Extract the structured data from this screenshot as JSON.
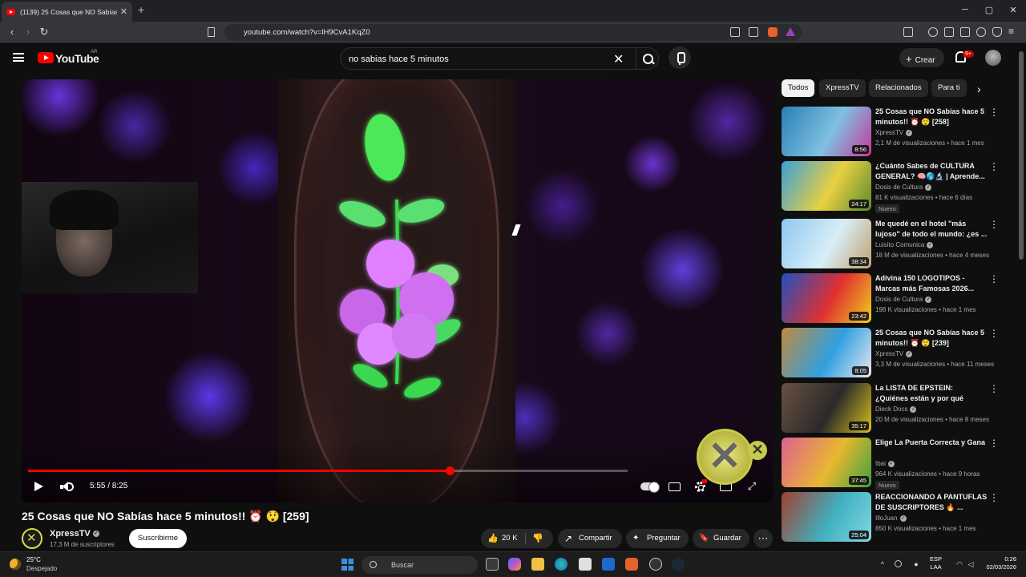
{
  "browser": {
    "tab_title": "(1139) 25 Cosas que NO Sabías",
    "tab_close": "✕",
    "new_tab": "+",
    "url": "youtube.com/watch?v=lH9CvA1KqZ0",
    "window_min": "─",
    "window_max": "▢",
    "window_close": "✕",
    "back": "‹",
    "forward": "›",
    "reload": "↻"
  },
  "youtube": {
    "logo_text": "YouTube",
    "country_code": "AR",
    "search_value": "no sabias hace 5 minutos",
    "search_clear": "✕",
    "create_label": "Crear",
    "notifications_badge": "9+"
  },
  "player": {
    "current_time": "5:55",
    "duration": "8:25",
    "time_display": "5:55 / 8:25",
    "progress_fraction": 0.703,
    "buffered_fraction": 1.0,
    "fullscreen_glyph": "⤢",
    "overlay_glyph": "✕"
  },
  "video": {
    "title": "25 Cosas que NO Sabías hace 5 minutos!! ⏰ 😲 [259]",
    "channel": "XpressTV",
    "verified": "✓",
    "subscribers": "17,3 M de suscriptores",
    "subscribe_label": "Suscribirme",
    "likes": "20 K",
    "like_icon": "👍",
    "dislike_icon": "👎",
    "share_label": "Compartir",
    "share_icon": "↗",
    "ask_label": "Preguntar",
    "ask_icon": "✦",
    "save_label": "Guardar",
    "save_icon": "🔖",
    "more_icon": "⋯"
  },
  "chips": [
    "Todos",
    "XpressTV",
    "Relacionados",
    "Para ti"
  ],
  "chip_next": "›",
  "recommendations": [
    {
      "title": "25 Cosas que NO Sabías hace 5 minutos!! ⏰ 😲 [258]",
      "channel": "XpressTV",
      "meta": "2,1 M de visualizaciones • hace 1 mes",
      "duration": "8:56",
      "badge": "",
      "thumb_colors": [
        "#2a7fb8",
        "#7fc0e0",
        "#c23a9a"
      ]
    },
    {
      "title": "¿Cuánto Sabes de CULTURA GENERAL? 🧠🌎🔬 | Aprende...",
      "channel": "Dosis de Cultura",
      "meta": "81 K visualizaciones • hace 6 días",
      "duration": "24:17",
      "badge": "Nuevo",
      "thumb_colors": [
        "#3aa0d8",
        "#e8d040",
        "#5a8a30"
      ]
    },
    {
      "title": "Me quedé en el hotel \"más lujoso\" de todo el mundo: ¿es ...",
      "channel": "Luisito Comunica",
      "meta": "18 M de visualizaciones • hace 4 meses",
      "duration": "38:34",
      "badge": "",
      "thumb_colors": [
        "#8ec8f0",
        "#d8eef8",
        "#c0a070"
      ]
    },
    {
      "title": "Adivina 150 LOGOTIPOS - Marcas más Famosas 2026...",
      "channel": "Dosis de Cultura",
      "meta": "198 K visualizaciones • hace 1 mes",
      "duration": "23:42",
      "badge": "",
      "thumb_colors": [
        "#2050c0",
        "#e03030",
        "#f0d020"
      ]
    },
    {
      "title": "25 Cosas que NO Sabías hace 5 minutos!! ⏰ 😲 [239]",
      "channel": "XpressTV",
      "meta": "3,3 M de visualizaciones • hace 11 meses",
      "duration": "8:05",
      "badge": "",
      "thumb_colors": [
        "#c08a40",
        "#30a0e0",
        "#e8e8f0"
      ]
    },
    {
      "title": "La LISTA DE EPSTEIN: ¿Quiénes están y por qué NADIE habla d...",
      "channel": "Dieck Docs",
      "meta": "20 M de visualizaciones • hace 8 meses",
      "duration": "35:17",
      "badge": "",
      "thumb_colors": [
        "#6a5040",
        "#2a2a2a",
        "#d8c020"
      ]
    },
    {
      "title": "Elige La Puerta Correcta y Gana",
      "channel": "Ibai",
      "meta": "964 K visualizaciones • hace 9 horas",
      "duration": "37:45",
      "badge": "Nuevo",
      "thumb_colors": [
        "#e06090",
        "#e8b830",
        "#40a040"
      ]
    },
    {
      "title": "REACCIONANDO A PANTUFLAS DE SUSCRIPTORES 🔥 ...",
      "channel": "IlloJuan",
      "meta": "850 K visualizaciones • hace 1 mes",
      "duration": "25:04",
      "badge": "",
      "thumb_colors": [
        "#a04030",
        "#40b0c0",
        "#80d8e0"
      ]
    }
  ],
  "rec_more_icon": "⋮",
  "taskbar": {
    "temperature": "25°C",
    "weather": "Despejado",
    "search_label": "Buscar",
    "lang_1": "ESP",
    "lang_2": "LAA",
    "time": "0:26",
    "date": "02/03/2026"
  }
}
